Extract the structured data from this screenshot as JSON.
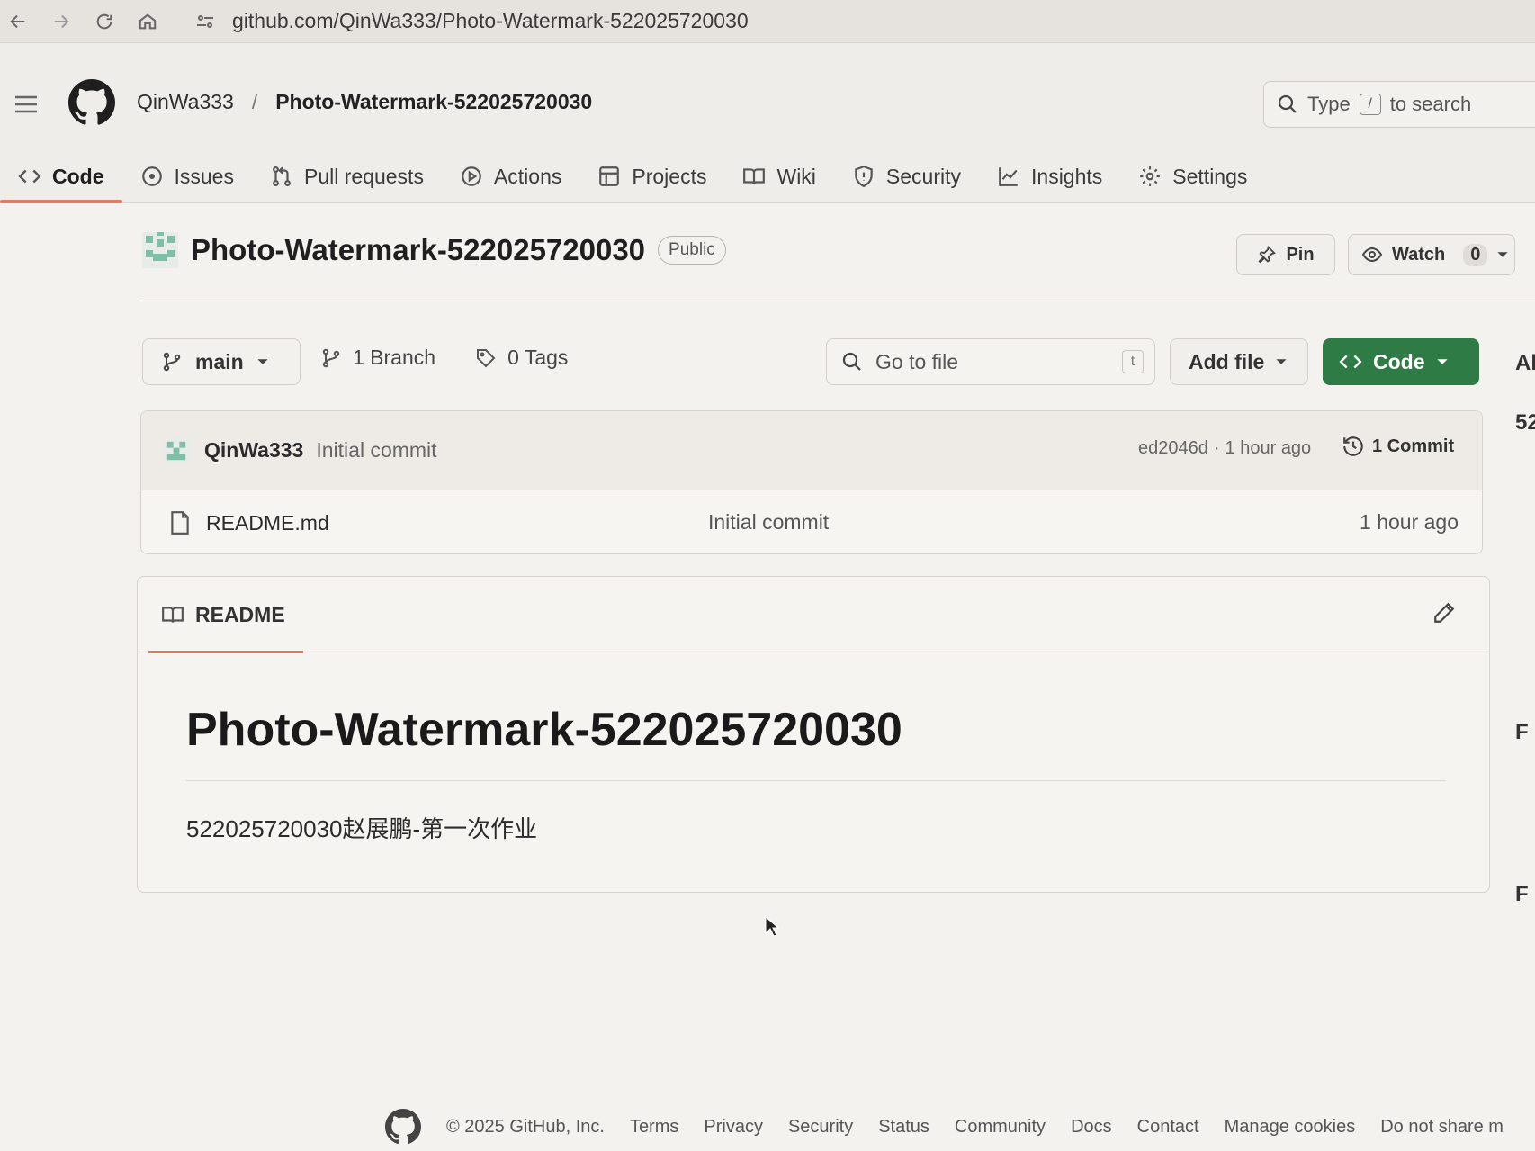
{
  "browser": {
    "url": "github.com/QinWa333/Photo-Watermark-522025720030"
  },
  "header": {
    "owner": "QinWa333",
    "separator": "/",
    "repo": "Photo-Watermark-522025720030",
    "search": {
      "prefix": "Type",
      "key": "/",
      "suffix": "to search"
    }
  },
  "tabs": [
    {
      "label": "Code",
      "icon": "code-icon",
      "active": true
    },
    {
      "label": "Issues",
      "icon": "issue-icon"
    },
    {
      "label": "Pull requests",
      "icon": "pull-request-icon"
    },
    {
      "label": "Actions",
      "icon": "play-icon"
    },
    {
      "label": "Projects",
      "icon": "table-icon"
    },
    {
      "label": "Wiki",
      "icon": "book-icon"
    },
    {
      "label": "Security",
      "icon": "shield-icon"
    },
    {
      "label": "Insights",
      "icon": "graph-icon"
    },
    {
      "label": "Settings",
      "icon": "gear-icon"
    }
  ],
  "repo": {
    "name": "Photo-Watermark-522025720030",
    "visibility": "Public",
    "pin_label": "Pin",
    "watch_label": "Watch",
    "watch_count": "0"
  },
  "branch_bar": {
    "branch": "main",
    "branch_count": "1 Branch",
    "tag_count": "0 Tags",
    "goto_placeholder": "Go to file",
    "goto_key": "t",
    "add_file": "Add file",
    "code": "Code"
  },
  "latest_commit": {
    "author": "QinWa333",
    "message": "Initial commit",
    "hash": "ed2046d",
    "dot": "·",
    "time": "1 hour ago",
    "commit_count": "1 Commit"
  },
  "files": [
    {
      "name": "README.md",
      "commit": "Initial commit",
      "time": "1 hour ago"
    }
  ],
  "readme": {
    "tab_label": "README",
    "heading": "Photo-Watermark-522025720030",
    "body": "522025720030赵展鹏-第一次作业"
  },
  "sidebar_clipped": [
    "Al",
    "52",
    "F",
    "F"
  ],
  "footer": {
    "copyright": "© 2025 GitHub, Inc.",
    "links": [
      "Terms",
      "Privacy",
      "Security",
      "Status",
      "Community",
      "Docs",
      "Contact",
      "Manage cookies",
      "Do not share m"
    ]
  },
  "colors": {
    "accent_underline": "#e07c62",
    "code_button": "#2f7b46"
  }
}
